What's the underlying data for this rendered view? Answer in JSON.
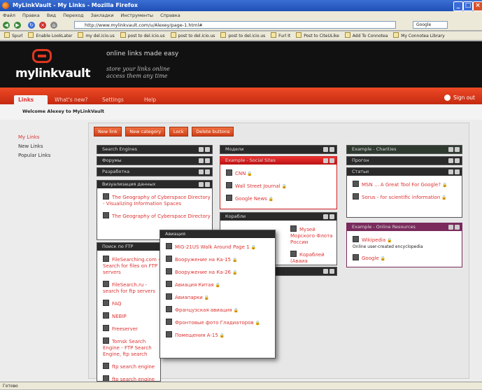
{
  "window": {
    "title": "MyLinkVault - My Links - Mozilla Firefox"
  },
  "menu": [
    "Файл",
    "Правка",
    "Вид",
    "Переход",
    "Закладки",
    "Инструменты",
    "Справка"
  ],
  "url": "http://www.mylinkvault.com/u/Alexey/page-1.html#",
  "search_placeholder": "Google",
  "bookmarks": [
    "Spurl",
    "Enable LookLater",
    "my del.icio.us",
    "post to del.icio.us",
    "post to del.icio.us",
    "post to del.icio.us",
    "Furl It",
    "Post to CiteULike",
    "Add To Connotea",
    "My Connotea Library"
  ],
  "site": {
    "logo": "mylinkvault",
    "tagline": "online links made easy",
    "tagline2": "store your links online\naccess them any time",
    "accent": "#e0361e"
  },
  "nav": {
    "tabs": [
      "Links",
      "What's new?",
      "Settings",
      "Help"
    ],
    "signout": "Sign out"
  },
  "welcome": "Welcome Alexey to MyLinkVault",
  "sidebar": [
    "My Links",
    "New Links",
    "Popular Links"
  ],
  "toolbar": [
    "New link",
    "New category",
    "Lock",
    "Delete buttons"
  ],
  "widgets": {
    "search": {
      "title": "Search Engines"
    },
    "forums": {
      "title": "Форумы"
    },
    "dev": {
      "title": "Разработка"
    },
    "viz": {
      "title": "Визуализация данных",
      "links": [
        "The Geography of Cyberspace Directory - Visualizing Information Spaces",
        "The Geography of Cyberspace Directory"
      ]
    },
    "ftp": {
      "title": "Поиск по FTP",
      "links": [
        "FileSearching.com - Search for files on FTP servers",
        "FileSearch.ru - search for ftp servers",
        "FAQ",
        "NEBIP",
        "Freeserver",
        "Tomsk Search Engine - FTP Search Engine, ftp search",
        "ftp search engine",
        "ftp search engine for finding free downloads"
      ]
    },
    "avia": {
      "title": "Авиация",
      "links": [
        "MiG-21US Walk Around Page 1",
        "Вооружение на Ка-15",
        "Вооружение на Ка-26",
        "Авиация Китая",
        "Авиапарки",
        "Французская авиация",
        "Фронтовые фото Гладиаторов",
        "Помещения А-15"
      ]
    },
    "models": {
      "title": "Модели"
    },
    "social": {
      "title": "Example - Social Sites",
      "links": [
        "CNN",
        "Wall Street Journal",
        "Google News"
      ]
    },
    "ships": {
      "title": "Корабли",
      "links": [
        "Музей Морского Флота России",
        "Кораблей (Аваиа"
      ]
    },
    "charities": {
      "title": "Example - Charities"
    },
    "prog": {
      "title": "Прогон"
    },
    "articles": {
      "title": "Статьи",
      "links": [
        "MSN ... A Great Tool For Google?",
        "Sorus - for scientific information"
      ]
    },
    "refs": {
      "title": "Example - Online Resources",
      "links": [
        "Wikipedia"
      ],
      "desc": "Online user-created encyclopedia",
      "links2": [
        "Google"
      ]
    },
    "blank": {
      "title": ""
    }
  },
  "status": "Готово"
}
